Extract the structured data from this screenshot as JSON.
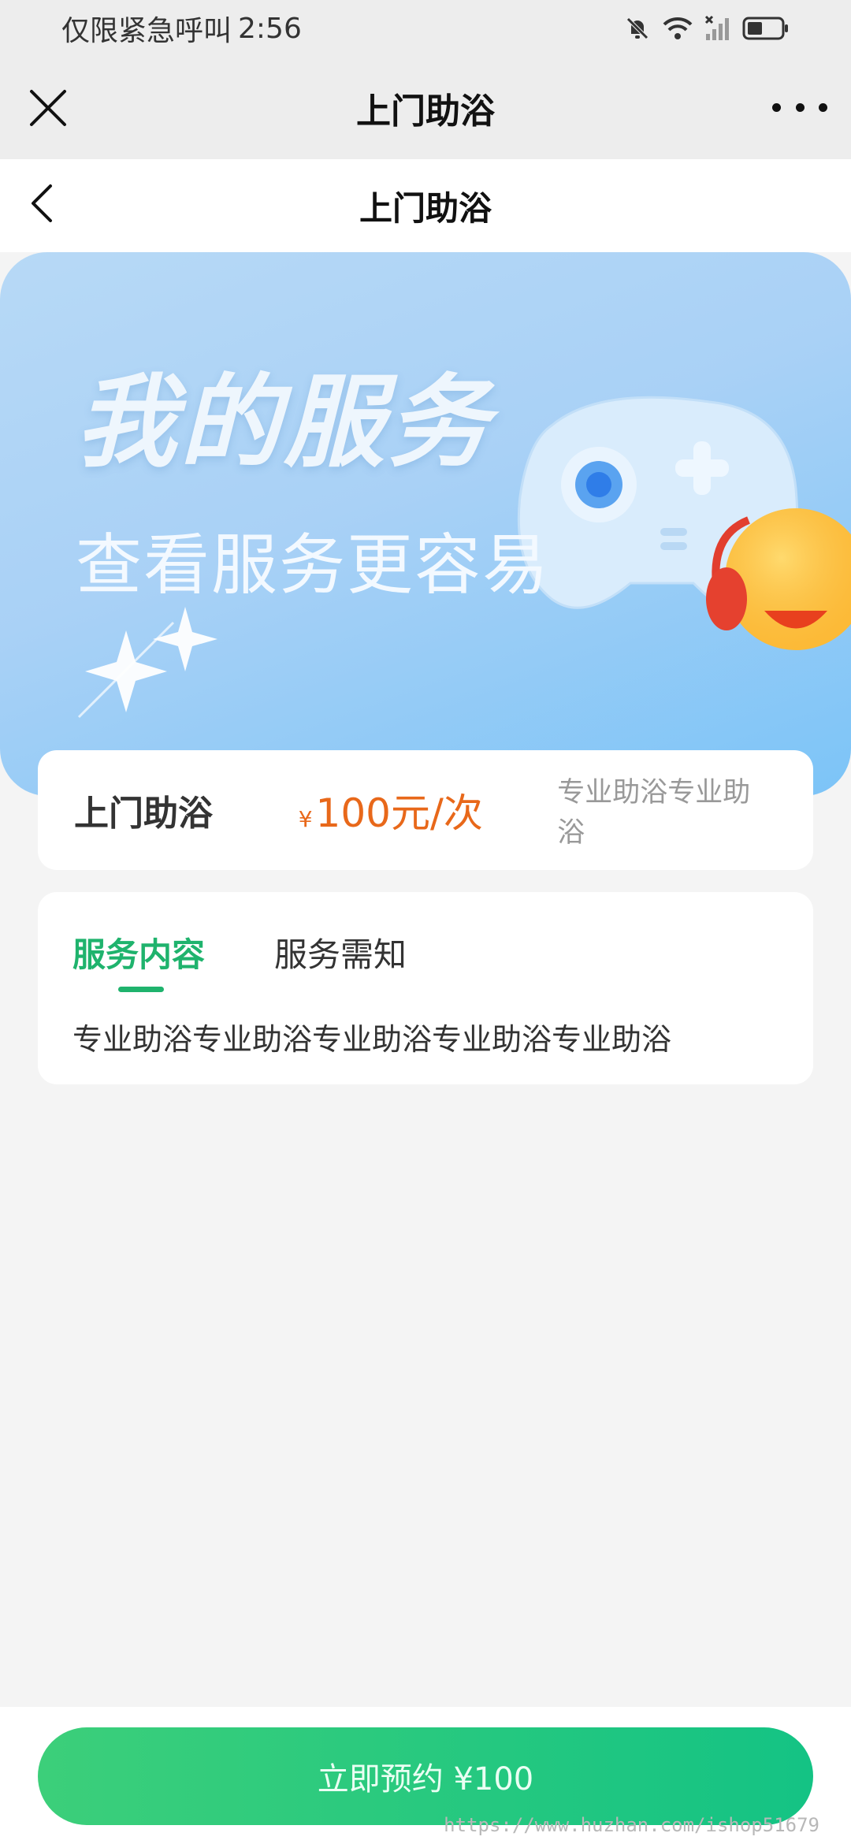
{
  "status_bar": {
    "carrier_text": "仅限紧急呼叫",
    "time": "2:56"
  },
  "wechat_bar": {
    "title": "上门助浴",
    "icons": [
      "close-icon",
      "more-icon"
    ]
  },
  "header": {
    "title": "上门助浴",
    "icons": [
      "back-icon"
    ]
  },
  "banner": {
    "title": "我的服务",
    "subtitle": "查看服务更容易",
    "colors": {
      "from": "#b7d9f6",
      "to": "#7cc4f7"
    }
  },
  "service": {
    "name": "上门助浴",
    "currency": "¥",
    "price": "100元/次",
    "description": "专业助浴专业助浴"
  },
  "detail": {
    "tabs": [
      {
        "label": "服务内容",
        "active": true
      },
      {
        "label": "服务需知",
        "active": false
      }
    ],
    "content": "专业助浴专业助浴专业助浴专业助浴专业助浴"
  },
  "footer": {
    "button_label": "立即预约 ¥100"
  },
  "watermark": "https://www.huzhan.com/ishop51679",
  "colors": {
    "accent": "#1fb36d",
    "price": "#e8681a"
  }
}
